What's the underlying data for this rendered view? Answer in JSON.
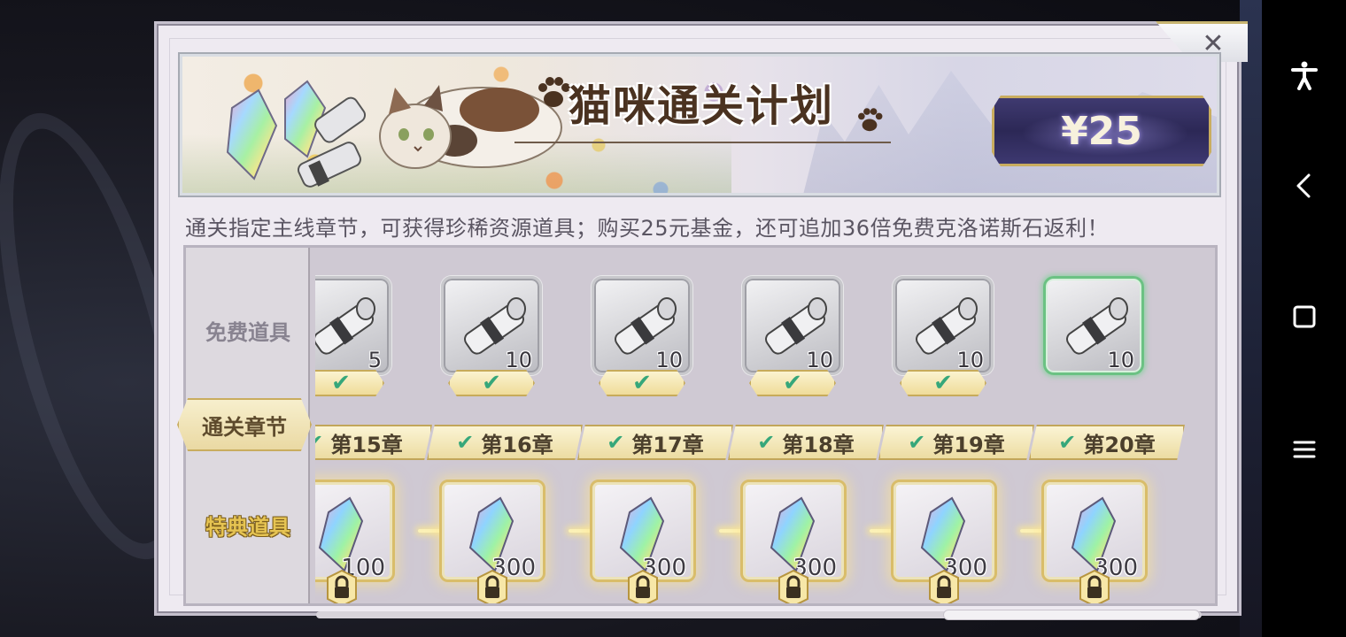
{
  "dialog": {
    "title": "猫咪通关计划",
    "price": "¥25",
    "description": "通关指定主线章节，可获得珍稀资源道具；购买25元基金，还可追加36倍免费克洛诺斯石返利！",
    "close_icon": "✕"
  },
  "rows": {
    "free_label": "免费道具",
    "chapter_label": "通关章节",
    "special_label": "特典道具"
  },
  "columns": [
    {
      "free_count": "5",
      "free_claimed": true,
      "chapter": "第15章",
      "special_count": "100"
    },
    {
      "free_count": "10",
      "free_claimed": true,
      "chapter": "第16章",
      "special_count": "300"
    },
    {
      "free_count": "10",
      "free_claimed": true,
      "chapter": "第17章",
      "special_count": "300"
    },
    {
      "free_count": "10",
      "free_claimed": true,
      "chapter": "第18章",
      "special_count": "300"
    },
    {
      "free_count": "10",
      "free_claimed": true,
      "chapter": "第19章",
      "special_count": "300"
    },
    {
      "free_count": "10",
      "free_claimed": false,
      "chapter": "第20章",
      "special_count": "300"
    }
  ],
  "icons": {
    "free_item": "scroll-icon",
    "special_item": "crystal-icon",
    "claimed": "check-icon",
    "locked": "lock-icon"
  },
  "colors": {
    "accent_gold": "#c9ad5f",
    "check_green": "#36a77a",
    "price_bg": "#2c2856",
    "highlight_green": "#6bc283"
  },
  "navbar": {
    "accessibility": "accessibility-icon",
    "back": "back-icon",
    "home": "home-square-icon",
    "menu": "menu-icon"
  }
}
